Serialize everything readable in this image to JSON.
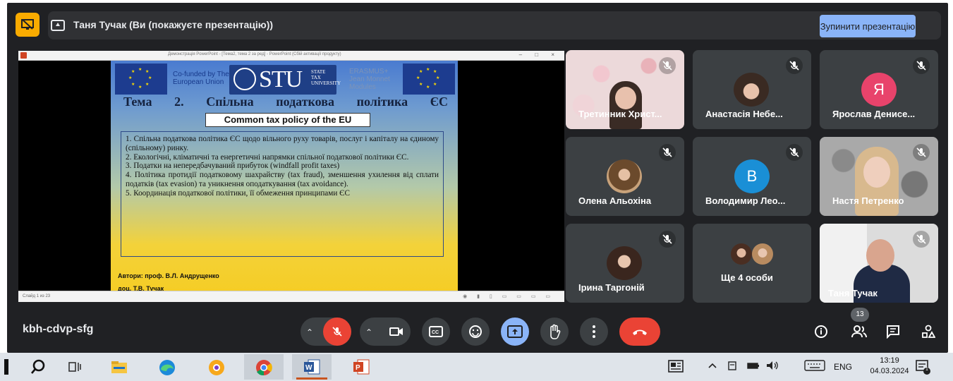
{
  "banner": {
    "presenter_text": "Таня Тучак (Ви (покажуєте презентацію))",
    "stop_button": "Зупинити презентацію"
  },
  "powerpoint": {
    "window_title": "Демонстрація PowerPoint - [Тема2, тема 2 за ред] - PowerPoint (Сбій активації продукту)",
    "slide_counter": "Слайд 1 из 23",
    "slide": {
      "cofunded": "Co-funded by The European Union",
      "stu_letters": "STU",
      "stu_subtitle": "STATE TAX UNIVERSITY",
      "erasmus": "ERASMUS+ Jean Monnet Modules",
      "heading": "Тема 2. Спільна податкова політика ЄС",
      "subtitle": "Common tax policy of the EU",
      "body": [
        "1. Спільна податкова політика ЄС щодо вільного руху товарів, послуг і капіталу на єдиному (спільному) ринку.",
        "2. Екологічні, кліматичні та енергетичні напрямки спільної податкової політики ЄС.",
        "3. Податки на непередбачуваний прибуток (windfall profit taxes)",
        "4. Політика протидії податковому шахрайству (tax fraud), зменшення ухилення від сплати податків (tax evasion) та уникнення оподаткування (tax avoidance).",
        "5. Координація податкової політики, її обмеження принципами ЄС"
      ],
      "authors_line1": "Автори: проф. В.Л. Андрущенко",
      "authors_line2": "доц. Т.В. Тучак"
    }
  },
  "participants": [
    {
      "name": "Третинник Христ...",
      "type": "video"
    },
    {
      "name": "Анастасія Небе...",
      "type": "photo"
    },
    {
      "name": "Ярослав Денисе...",
      "type": "letter",
      "letter": "Я",
      "color": "#e8436b"
    },
    {
      "name": "Олена Альохіна",
      "type": "photo"
    },
    {
      "name": "Володимир Лео...",
      "type": "letter",
      "letter": "B",
      "color": "#1a8fd6"
    },
    {
      "name": "Настя Петренко",
      "type": "video"
    },
    {
      "name": "Ірина Таргоній",
      "type": "photo"
    },
    {
      "name": "Ще 4 особи",
      "type": "group"
    },
    {
      "name": "Таня Тучак",
      "type": "video"
    }
  ],
  "controls": {
    "meeting_code": "kbh-cdvp-sfg",
    "people_count": "13",
    "colors": {
      "end_call": "#ea4335",
      "mic_off": "#ea4335",
      "present": "#8ab4f8"
    }
  },
  "taskbar": {
    "language": "ENG",
    "time": "13:19",
    "date": "04.03.2024",
    "notification_count": "1"
  }
}
